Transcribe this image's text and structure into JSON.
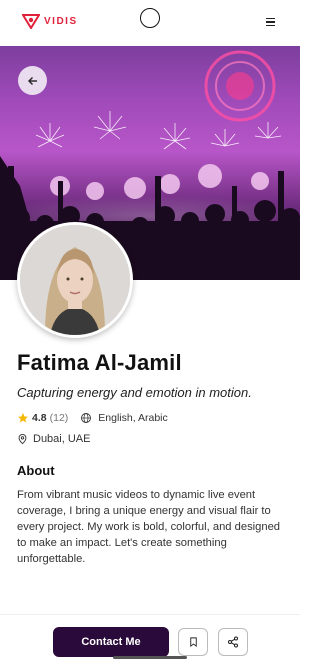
{
  "app": {
    "logo_text": "VIDIS",
    "brand_color": "#e0223b",
    "accent_dark": "#2a0a3a"
  },
  "header": {
    "menu_icon": "hamburger-menu-icon",
    "back_icon": "arrow-left-icon"
  },
  "profile": {
    "name": "Fatima Al-Jamil",
    "tagline": "Capturing energy and emotion in motion.",
    "rating": "4.8",
    "review_count": "(12)",
    "languages": "English, Arabic",
    "location": "Dubai, UAE"
  },
  "about": {
    "title": "About",
    "text": "From vibrant music videos to dynamic live event coverage, I bring a unique energy and visual flair to every project. My work is bold, colorful, and designed to make an impact. Let's create something unforgettable."
  },
  "actions": {
    "contact_label": "Contact Me",
    "bookmark_icon": "bookmark-icon",
    "share_icon": "share-icon"
  }
}
